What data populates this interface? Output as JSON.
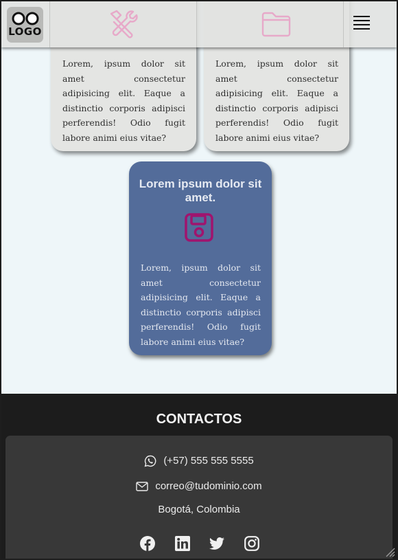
{
  "header": {
    "logo_text": "LOGO",
    "icons": [
      "hammer-wrench-icon",
      "folder-icon"
    ],
    "menu_icon": "hamburger-menu-icon"
  },
  "cards": [
    {
      "text": "Lorem, ipsum dolor sit amet consectetur adipisicing elit. Eaque a distinctio corporis adipisci perferendis! Odio fugit labore animi eius vitae?"
    },
    {
      "text": "Lorem, ipsum dolor sit amet consectetur adipisicing elit. Eaque a distinctio corporis adipisci perferendis! Odio fugit labore animi eius vitae?"
    },
    {
      "title": "Lorem ipsum dolor sit amet.",
      "icon": "floppy-disk-icon",
      "text": "Lorem, ipsum dolor sit amet consectetur adipisicing elit. Eaque a distinctio corporis adipisci perferendis! Odio fugit labore animi eius vitae?"
    }
  ],
  "footer": {
    "title": "CONTACTOS",
    "phone": "(+57) 555 555 5555",
    "email": "correo@tudominio.com",
    "city": "Bogotá, Colombia",
    "social": [
      "facebook-icon",
      "linkedin-icon",
      "twitter-icon",
      "instagram-icon"
    ]
  },
  "colors": {
    "page_bg": "#eef6f9",
    "card_bg": "#e4e5e3",
    "feature_card_bg": "#536c9a",
    "icon_accent": "#a0146e",
    "icon_faded": "#e7a9c9",
    "footer_bg": "#1c1c1c",
    "contact_box_bg": "#383838"
  }
}
